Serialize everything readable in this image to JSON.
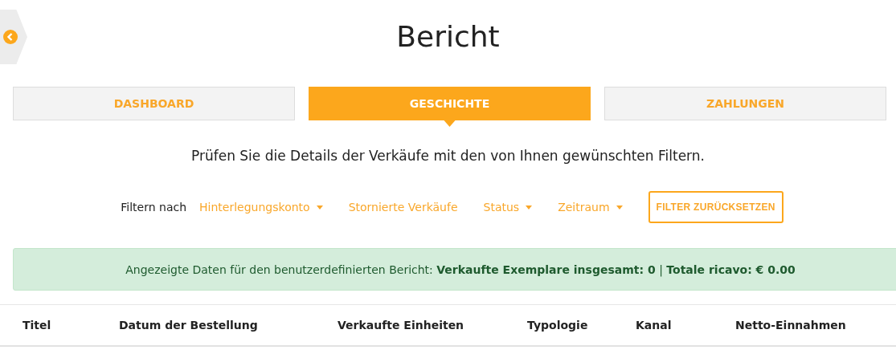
{
  "title": "Bericht",
  "tabs": [
    {
      "label": "DASHBOARD",
      "selected": false
    },
    {
      "label": "GESCHICHTE",
      "selected": true
    },
    {
      "label": "ZAHLUNGEN",
      "selected": false
    }
  ],
  "subtitle": "Prüfen Sie die Details der Verkäufe mit den von Ihnen gewünschten Filtern.",
  "filters": {
    "label": "Filtern nach",
    "items": [
      {
        "kind": "dropdown",
        "label": "Hinterlegungskonto"
      },
      {
        "kind": "link",
        "label": "Stornierte Verkäufe"
      },
      {
        "kind": "dropdown",
        "label": "Status"
      },
      {
        "kind": "dropdown",
        "label": "Zeitraum"
      },
      {
        "kind": "button",
        "label": "FILTER ZURÜCKSETZEN"
      }
    ]
  },
  "alert": "Angezeigte Daten für den benutzerdefinierten Bericht: **Verkaufte Exemplare insgesamt: 0** | **Totale ricavo: € 0.00**",
  "table": {
    "columns": [
      "Titel",
      "Datum der Bestellung",
      "Verkaufte Einheiten",
      "Typologie",
      "Kanal",
      "Netto-Einnahmen"
    ]
  }
}
